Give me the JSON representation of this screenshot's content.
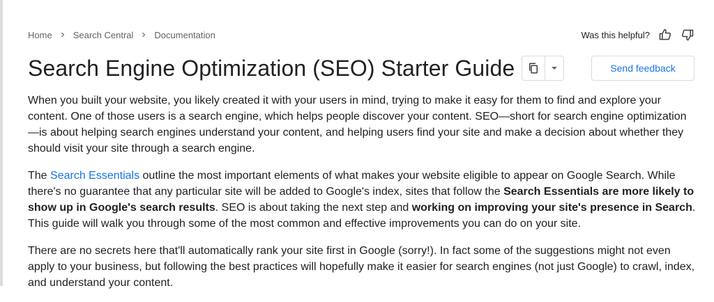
{
  "breadcrumb": [
    "Home",
    "Search Central",
    "Documentation"
  ],
  "helpful": {
    "prompt": "Was this helpful?",
    "up_icon": "thumb-up-icon",
    "down_icon": "thumb-down-icon"
  },
  "page": {
    "title": "Search Engine Optimization (SEO) Starter Guide",
    "copy_icon": "copy-icon",
    "dropdown_icon": "caret-down-icon",
    "feedback_label": "Send feedback"
  },
  "paragraphs": {
    "p1": "When you built your website, you likely created it with your users in mind, trying to make it easy for them to find and explore your content. One of those users is a search engine, which helps people discover your content. SEO—short for search engine optimization—is about helping search engines understand your content, and helping users find your site and make a decision about whether they should visit your site through a search engine.",
    "p2": {
      "t1": "The ",
      "link": "Search Essentials",
      "t2": " outline the most important elements of what makes your website eligible to appear on Google Search. While there's no guarantee that any particular site will be added to Google's index, sites that follow the ",
      "b1": "Search Essentials are more likely to show up in Google's search results",
      "t3": ". SEO is about taking the next step and ",
      "b2": "working on improving your site's presence in Search",
      "t4": ". This guide will walk you through some of the most common and effective improvements you can do on your site."
    },
    "p3": "There are no secrets here that'll automatically rank your site first in Google (sorry!). In fact some of the suggestions might not even apply to your business, but following the best practices will hopefully make it easier for search engines (not just Google) to crawl, index, and understand your content."
  },
  "colors": {
    "link": "#1a73e8",
    "text": "#202124",
    "muted": "#5f6368",
    "border": "#dadce0"
  }
}
